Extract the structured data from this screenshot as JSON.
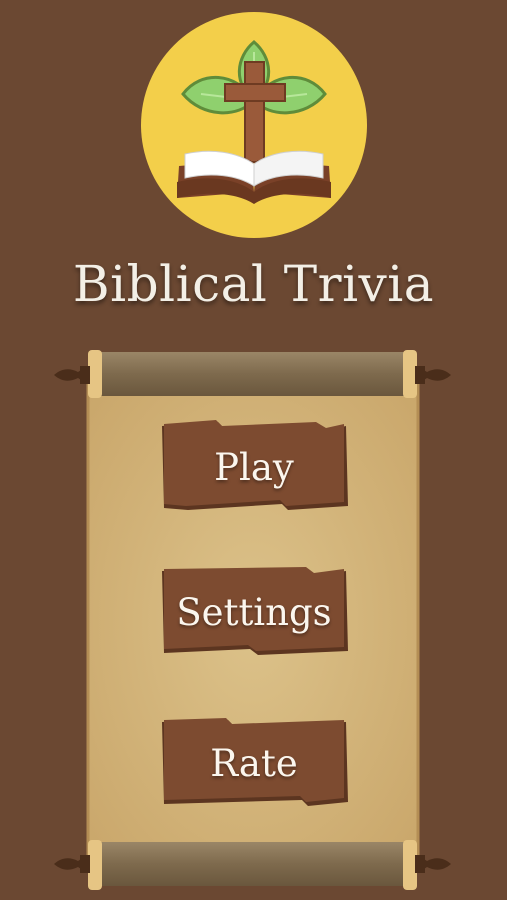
{
  "app": {
    "title": "Biblical Trivia",
    "logo_icon": "cross-bible-leaves-icon"
  },
  "menu": {
    "items": [
      {
        "id": "play",
        "label": "Play"
      },
      {
        "id": "settings",
        "label": "Settings"
      },
      {
        "id": "rate",
        "label": "Rate"
      }
    ]
  },
  "colors": {
    "background": "#6b4832",
    "logo_circle": "#f3cf4a",
    "leaf": "#8fd06e",
    "cross": "#9a5a3a",
    "parchment": "#d4b57d",
    "button": "#7d4b30",
    "title_text": "#f3efe6"
  }
}
